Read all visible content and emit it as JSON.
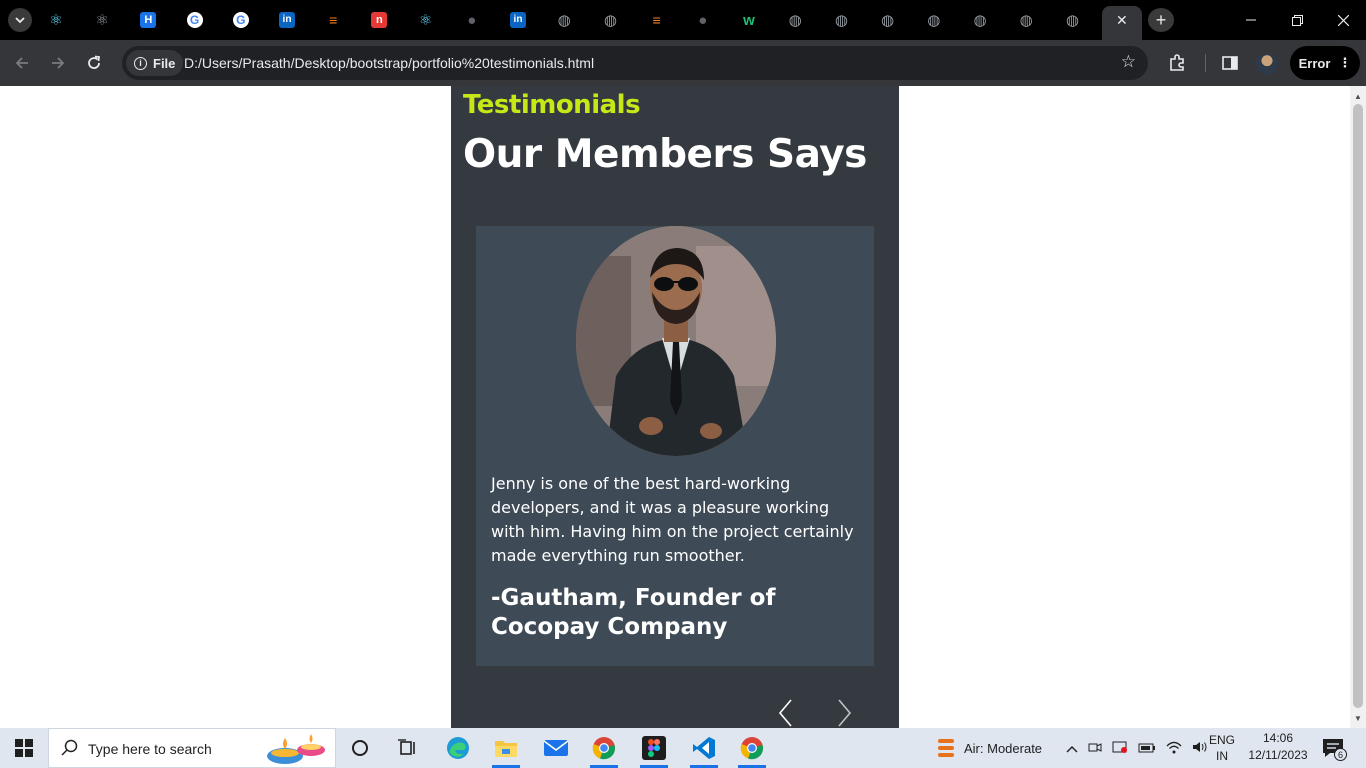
{
  "browser": {
    "tabs": [
      {
        "icon": "react-icon",
        "glyph": "⚛"
      },
      {
        "icon": "react-grey-icon",
        "glyph": "⚛"
      },
      {
        "icon": "hackerrank-icon",
        "glyph": "H"
      },
      {
        "icon": "google-icon",
        "glyph": "G"
      },
      {
        "icon": "google-icon",
        "glyph": "G"
      },
      {
        "icon": "linkedin-icon",
        "glyph": "in"
      },
      {
        "icon": "stackoverflow-icon",
        "glyph": "≡"
      },
      {
        "icon": "codeninja-icon",
        "glyph": "n"
      },
      {
        "icon": "react-icon",
        "glyph": "⚛"
      },
      {
        "icon": "github-icon",
        "glyph": "●"
      },
      {
        "icon": "linkedin-icon",
        "glyph": "in"
      },
      {
        "icon": "globe-icon",
        "glyph": "◍"
      },
      {
        "icon": "globe-icon",
        "glyph": "◍"
      },
      {
        "icon": "stackoverflow-icon",
        "glyph": "≡"
      },
      {
        "icon": "github-icon",
        "glyph": "●"
      },
      {
        "icon": "w-icon",
        "glyph": "w"
      },
      {
        "icon": "globe-icon",
        "glyph": "◍"
      },
      {
        "icon": "globe-icon",
        "glyph": "◍"
      },
      {
        "icon": "globe-icon",
        "glyph": "◍"
      },
      {
        "icon": "globe-icon",
        "glyph": "◍"
      },
      {
        "icon": "globe-icon",
        "glyph": "◍"
      },
      {
        "icon": "globe-icon",
        "glyph": "◍"
      },
      {
        "icon": "globe-icon",
        "glyph": "◍"
      }
    ],
    "site_chip_label": "File",
    "url": "D:/Users/Prasath/Desktop/bootstrap/portfolio%20testimonials.html",
    "error_label": "Error"
  },
  "page": {
    "eyebrow": "Testimonials",
    "heading": "Our Members Says",
    "testimonial": {
      "quote": "Jenny is one of the best hard-working developers, and it was a pleasure working with him. Having him on the project certainly made everything run smoother.",
      "author": "-Gautham, Founder of Cocopay Company"
    }
  },
  "colors": {
    "section_bg": "#343a40",
    "card_bg": "#3e4a56",
    "accent": "#c6e816",
    "browser_dark": "#35363a"
  },
  "taskbar": {
    "search_placeholder": "Type here to search",
    "weather": "Air: Moderate",
    "lang_line1": "ENG",
    "lang_line2": "IN",
    "time": "14:06",
    "date": "12/11/2023",
    "notification_count": "6",
    "apps": [
      "cortana-icon",
      "task-view-icon",
      "edge-icon",
      "file-explorer-icon",
      "mail-icon",
      "chrome-icon",
      "figma-icon",
      "vscode-icon",
      "chrome-icon"
    ]
  }
}
